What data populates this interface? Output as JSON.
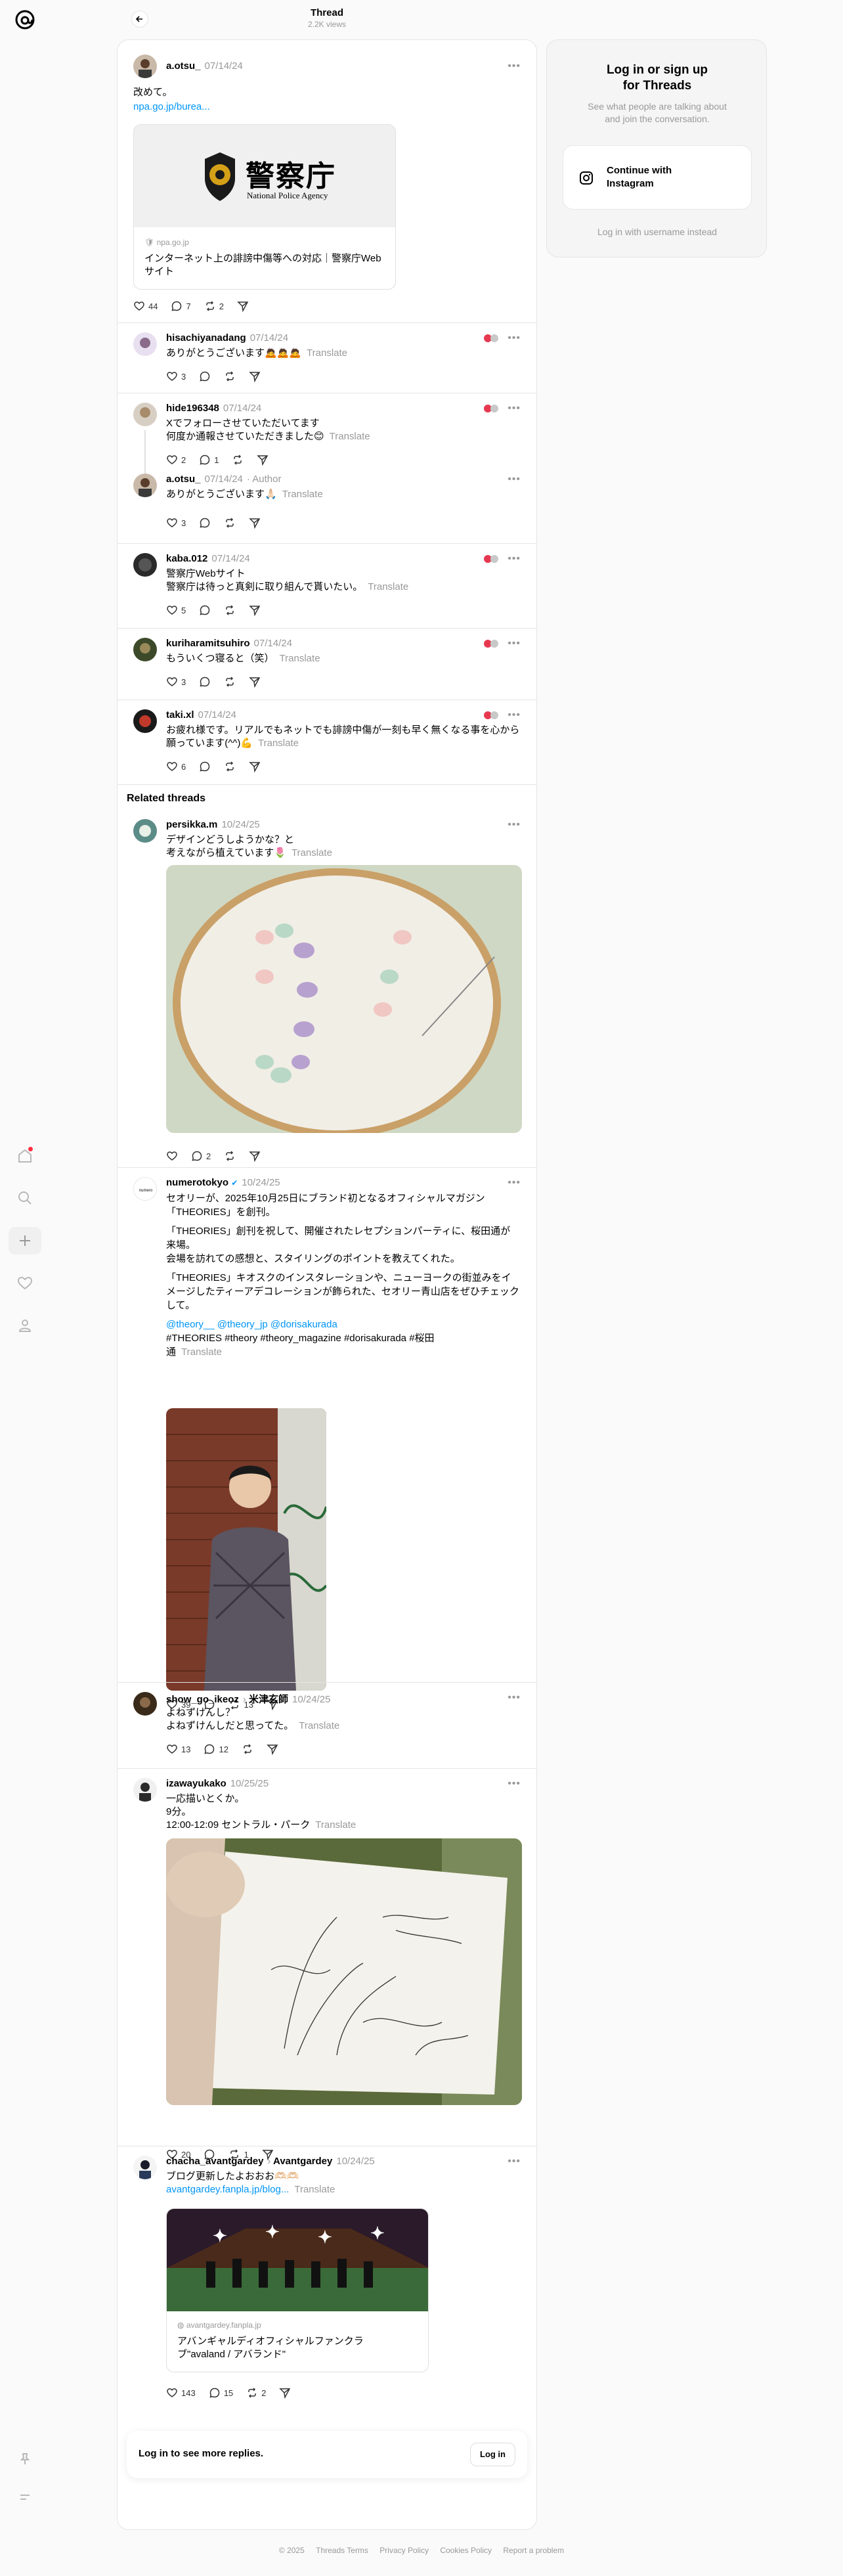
{
  "header": {
    "title": "Thread",
    "views": "2.2K views"
  },
  "main_post": {
    "user": "a.otsu_",
    "time": "07/14/24",
    "line1": "改めて。",
    "link": "npa.go.jp/burea...",
    "card": {
      "logo_text": "警察庁",
      "logo_sub": "National Police Agency",
      "domain": "npa.go.jp",
      "title1": "インターネット上の誹謗中傷等への対応｜警察庁Web",
      "title2": "サイト"
    },
    "likes": "44",
    "replies": "7",
    "reposts": "2"
  },
  "replies": [
    {
      "user": "hisachiyanadang",
      "time": "07/14/24",
      "lines": [
        "ありがとうございます🙇🙇🙇"
      ],
      "translate": "Translate",
      "likes": "3"
    },
    {
      "user": "hide196348",
      "time": "07/14/24",
      "lines": [
        "Xでフォローさせていただいてます",
        "何度か通報させていただきました😊"
      ],
      "translate": "Translate",
      "likes": "2",
      "replies": "1"
    },
    {
      "user": "a.otsu_",
      "time": "07/14/24",
      "author": "· Author",
      "lines": [
        "ありがとうございます🙏🏻"
      ],
      "translate": "Translate",
      "likes": "3"
    },
    {
      "user": "kaba.012",
      "time": "07/14/24",
      "lines": [
        "警察庁Webサイト",
        "警察庁は待っと真剣に取り組んで貰いたい。"
      ],
      "translate": "Translate",
      "likes": "5"
    },
    {
      "user": "kuriharamitsuhiro",
      "time": "07/14/24",
      "lines": [
        "もういくつ寝ると（笑）"
      ],
      "translate": "Translate",
      "likes": "3"
    },
    {
      "user": "taki.xl",
      "time": "07/14/24",
      "lines": [
        "お疲れ様です。リアルでもネットでも誹謗中傷が一刻も早く無くなる事を心から",
        "願っています(^^)💪"
      ],
      "translate": "Translate",
      "likes": "6"
    }
  ],
  "related_title": "Related threads",
  "related": [
    {
      "user": "persikka.m",
      "time": "10/24/25",
      "lines": [
        "デザインどうしようかな？と",
        "考えながら植えています🌷"
      ],
      "translate": "Translate",
      "likes": "",
      "replies": "2"
    },
    {
      "user": "numerotokyo",
      "time": "10/24/25",
      "lines": [
        "セオリーが、2025年10月25日にブランド初となるオフィシャルマガジン",
        "「THEORIES」を創刊。",
        "「THEORIES」創刊を祝して、開催されたレセプションパーティに、桜田通が",
        "来場。",
        "会場を訪れての感想と、スタイリングのポイントを教えてくれた。",
        "「THEORIES」キオスクのインスタレーションや、ニューヨークの街並みをイ",
        "メージしたティーアデコレーションが飾られた、セオリー青山店をぜひチェック",
        "して。"
      ],
      "mentions": "@theory__ @theory_jp @dorisakurada",
      "tags1": "#THEORIES #theory #theory_magazine #dorisakurada #桜田",
      "tags2": "通",
      "translate": "Translate",
      "likes": "39",
      "reposts": "13"
    },
    {
      "user": "show_go_ikeoz",
      "with": "米津玄師",
      "time": "10/24/25",
      "lines": [
        "よねずけんし？",
        "よねずけんしだと思ってた。"
      ],
      "translate": "Translate",
      "likes": "13",
      "replies": "12"
    },
    {
      "user": "izawayukako",
      "time": "10/25/25",
      "lines": [
        "一応描いとくか。",
        "9分。",
        "12:00-12:09 セントラル・パーク"
      ],
      "translate": "Translate",
      "likes": "20",
      "reposts": "1"
    },
    {
      "user": "chacha_avantgardey",
      "with": "Avantgardey",
      "time": "10/24/25",
      "lines": [
        "ブログ更新したよおおお🫶🏻🫶🏻"
      ],
      "link": "avantgardey.fanpla.jp/blog...",
      "translate": "Translate",
      "card": {
        "domain": "avantgardey.fanpla.jp",
        "title1": "アバンギャルディオフィシャルファンクラ",
        "title2": "ブ\"avaland / アバランド\""
      },
      "likes": "143",
      "replies": "15",
      "reposts": "2"
    }
  ],
  "loginbar": {
    "text": "Log in to see more replies.",
    "button": "Log in"
  },
  "right_panel": {
    "title1": "Log in or sign up",
    "title2": "for Threads",
    "sub1": "See what people are talking about",
    "sub2": "and join the conversation.",
    "insta1": "Continue with",
    "insta2": "Instagram",
    "alt": "Log in with username instead"
  },
  "footer": {
    "copy": "© 2025",
    "links": [
      "Threads Terms",
      "Privacy Policy",
      "Cookies Policy",
      "Report a problem"
    ]
  }
}
